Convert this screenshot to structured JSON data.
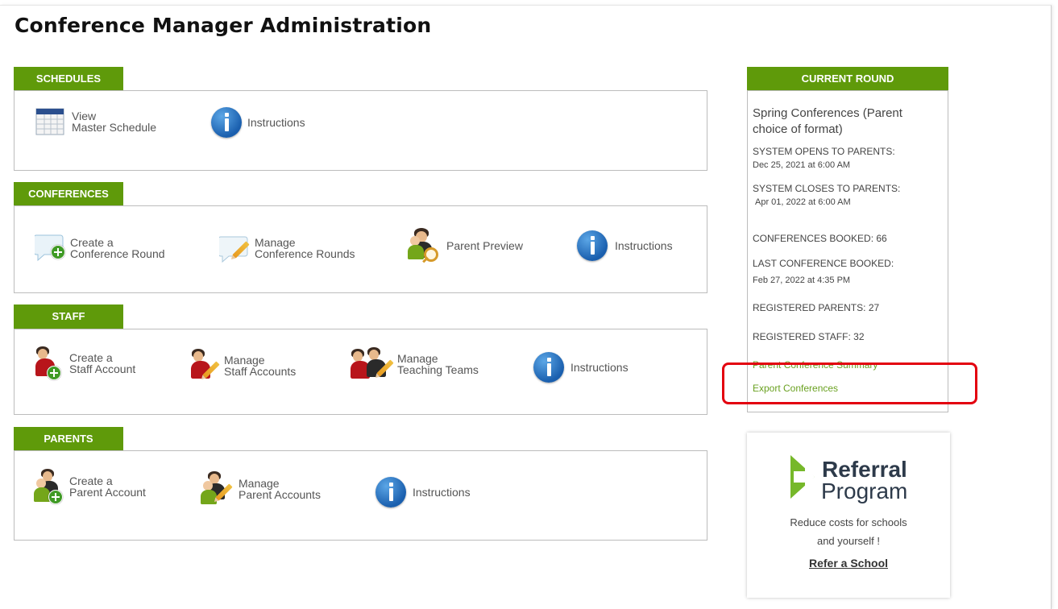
{
  "page": {
    "title": "Conference Manager Administration"
  },
  "schedules": {
    "tab": "SCHEDULES",
    "view_line1": "View",
    "view_line2": "Master Schedule",
    "instructions": "Instructions"
  },
  "conferences": {
    "tab": "CONFERENCES",
    "create_line1": "Create a",
    "create_line2": "Conference Round",
    "manage_line1": "Manage",
    "manage_line2": "Conference Rounds",
    "preview": "Parent Preview",
    "instructions": "Instructions"
  },
  "staff": {
    "tab": "STAFF",
    "create_line1": "Create a",
    "create_line2": "Staff Account",
    "manage_line1": "Manage",
    "manage_line2": "Staff Accounts",
    "teams_line1": "Manage",
    "teams_line2": "Teaching Teams",
    "instructions": "Instructions"
  },
  "parents": {
    "tab": "PARENTS",
    "create_line1": "Create a",
    "create_line2": "Parent Account",
    "manage_line1": "Manage",
    "manage_line2": "Parent Accounts",
    "instructions": "Instructions"
  },
  "current_round": {
    "tab": "CURRENT ROUND",
    "name_line1": "Spring Conferences (Parent",
    "name_line2": "choice of format)",
    "opens_label": "SYSTEM OPENS TO PARENTS:",
    "opens_value": "Dec 25, 2021 at 6:00 AM",
    "closes_label": "SYSTEM CLOSES TO PARENTS:",
    "closes_value": "Apr 01, 2022 at 6:00 AM",
    "booked_label": "CONFERENCES BOOKED:",
    "booked_value": "66",
    "last_label": "LAST CONFERENCE BOOKED:",
    "last_value": "Feb 27, 2022 at 4:35 PM",
    "reg_parents_label": "REGISTERED PARENTS:",
    "reg_parents_value": "27",
    "reg_staff_label": "REGISTERED STAFF:",
    "reg_staff_value": "32",
    "summary_link": "Parent Conference Summary",
    "export_link": "Export Conferences"
  },
  "referral": {
    "title_line1": "Referral",
    "title_line2": "Program",
    "desc_line1": "Reduce costs for schools",
    "desc_line2": "and yourself !",
    "link": "Refer a School"
  },
  "colors": {
    "accent": "#5f9a0a",
    "link_green": "#6aa121",
    "highlight_red": "#e3000f",
    "info_blue": "#1a5fae"
  }
}
